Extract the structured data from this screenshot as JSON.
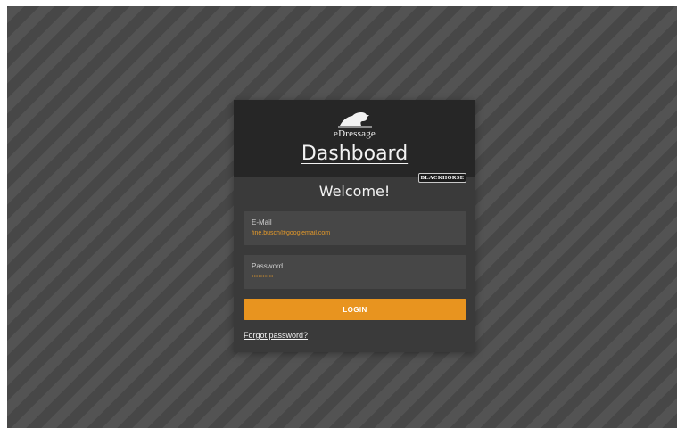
{
  "header": {
    "logo_icon": "horse-head-logo-icon",
    "logo_text": "eDressage",
    "title": "Dashboard",
    "badge": "BLACKHORSE"
  },
  "form": {
    "welcome": "Welcome!",
    "email": {
      "label": "E-Mail",
      "value": "fine.busch@googlemail.com"
    },
    "password": {
      "label": "Password",
      "value": "••••••••••"
    },
    "login_label": "LOGIN",
    "forgot_label": "Forgot password?"
  },
  "colors": {
    "accent": "#e8941f",
    "input_text": "#e59a2a",
    "card": "#3a3a3a",
    "header": "#262626"
  }
}
